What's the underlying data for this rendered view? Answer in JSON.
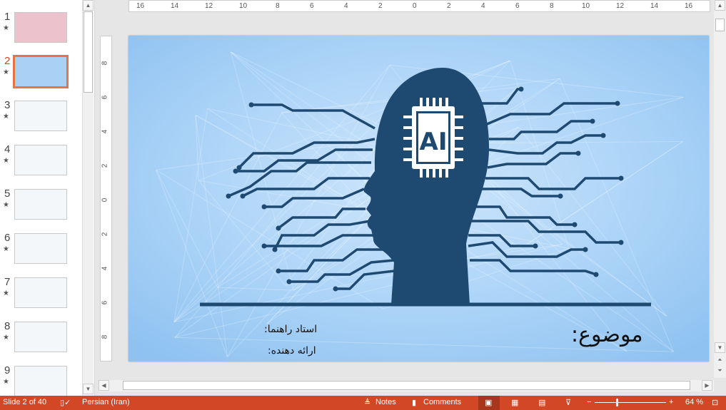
{
  "thumbnails": [
    {
      "number": "1",
      "star": "★",
      "bg": "#ecc3cc"
    },
    {
      "number": "2",
      "star": "★",
      "bg": "#a9d1f5",
      "selected": true
    },
    {
      "number": "3",
      "star": "★",
      "bg": "#f4f7fa"
    },
    {
      "number": "4",
      "star": "★",
      "bg": "#f4f7fa"
    },
    {
      "number": "5",
      "star": "★",
      "bg": "#f4f7fa"
    },
    {
      "number": "6",
      "star": "★",
      "bg": "#f4f7fa"
    },
    {
      "number": "7",
      "star": "★",
      "bg": "#f4f7fa"
    },
    {
      "number": "8",
      "star": "★",
      "bg": "#f4f7fa"
    },
    {
      "number": "9",
      "star": "★",
      "bg": "#f4f7fa"
    }
  ],
  "rulers": {
    "horizontal": [
      "16",
      "14",
      "12",
      "10",
      "8",
      "6",
      "4",
      "2",
      "0",
      "2",
      "4",
      "6",
      "8",
      "10",
      "12",
      "14",
      "16"
    ],
    "vertical": [
      "8",
      "6",
      "4",
      "2",
      "0",
      "2",
      "4",
      "6",
      "8"
    ]
  },
  "slide": {
    "chip_label": "AI",
    "topic_label": "موضوع:",
    "advisor_label": "استاد راهنما:",
    "presenter_label": "ارائه دهنده:",
    "colors": {
      "background": "#a8d0f6",
      "silhouette": "#1e4a72"
    }
  },
  "status": {
    "slide_counter": "Slide 2 of 40",
    "language": "Persian (Iran)",
    "notes": "Notes",
    "comments": "Comments",
    "zoom": "64 %",
    "zoom_level_percent": 64,
    "accent": "#d24726"
  }
}
